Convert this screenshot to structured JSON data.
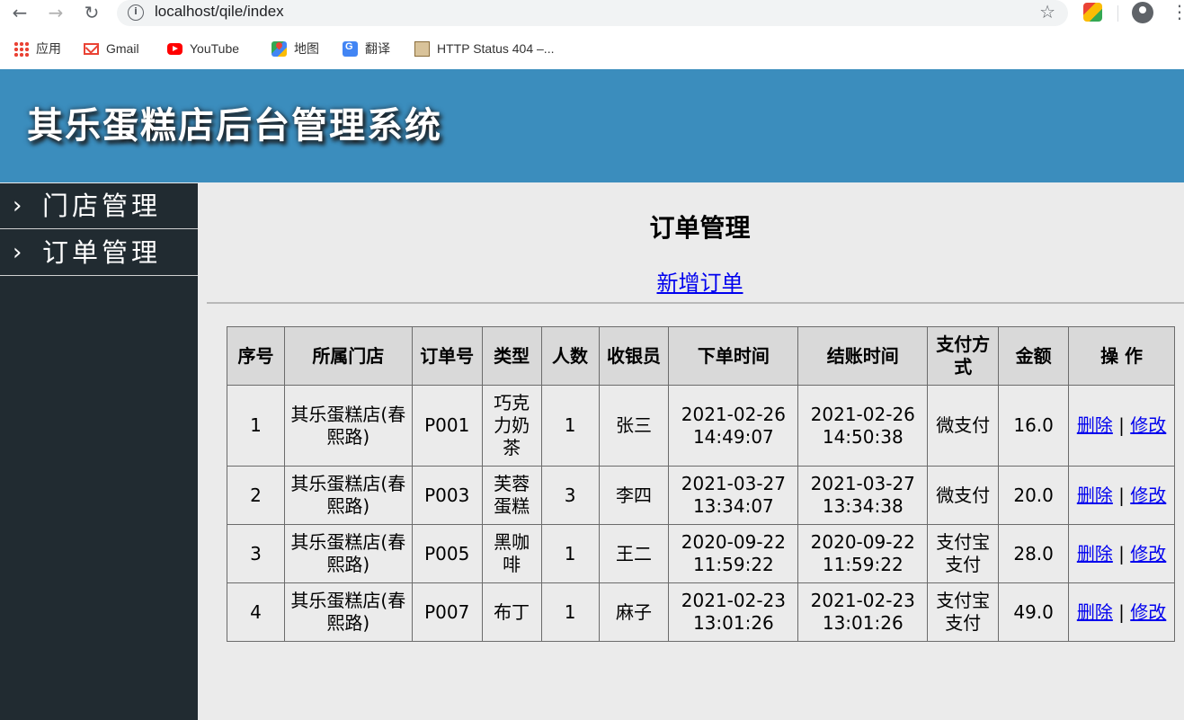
{
  "browser": {
    "url": "localhost/qile/index",
    "bookmarks": [
      {
        "label": "应用",
        "icon": "apps-grid-icon"
      },
      {
        "label": "Gmail",
        "icon": "gmail-icon"
      },
      {
        "label": "YouTube",
        "icon": "youtube-icon"
      },
      {
        "label": "地图",
        "icon": "maps-icon"
      },
      {
        "label": "翻译",
        "icon": "translate-icon"
      },
      {
        "label": "HTTP Status 404 –...",
        "icon": "tomcat-icon"
      }
    ]
  },
  "header": {
    "title": "其乐蛋糕店后台管理系统",
    "bg_color": "#3b8dbd"
  },
  "sidebar": {
    "bg_color": "#212b31",
    "items": [
      {
        "label": "门店管理"
      },
      {
        "label": "订单管理"
      }
    ]
  },
  "main": {
    "title": "订单管理",
    "add_link": "新增订单",
    "table": {
      "headers": [
        "序号",
        "所属门店",
        "订单号",
        "类型",
        "人数",
        "收银员",
        "下单时间",
        "结账时间",
        "支付方式",
        "金额",
        "操 作"
      ],
      "delete_label": "删除",
      "edit_label": "修改",
      "action_sep": "|",
      "rows": [
        {
          "no": "1",
          "store": "其乐蛋糕店(春熙路)",
          "order_no": "P001",
          "type": "巧克力奶茶",
          "people": "1",
          "cashier": "张三",
          "order_date": "2021-02-26",
          "order_time": "14:49:07",
          "pay_date": "2021-02-26",
          "pay_time": "14:50:38",
          "payment": "微支付",
          "amount": "16.0"
        },
        {
          "no": "2",
          "store": "其乐蛋糕店(春熙路)",
          "order_no": "P003",
          "type": "芙蓉蛋糕",
          "people": "3",
          "cashier": "李四",
          "order_date": "2021-03-27",
          "order_time": "13:34:07",
          "pay_date": "2021-03-27",
          "pay_time": "13:34:38",
          "payment": "微支付",
          "amount": "20.0"
        },
        {
          "no": "3",
          "store": "其乐蛋糕店(春熙路)",
          "order_no": "P005",
          "type": "黑咖啡",
          "people": "1",
          "cashier": "王二",
          "order_date": "2020-09-22",
          "order_time": "11:59:22",
          "pay_date": "2020-09-22",
          "pay_time": "11:59:22",
          "payment": "支付宝支付",
          "amount": "28.0"
        },
        {
          "no": "4",
          "store": "其乐蛋糕店(春熙路)",
          "order_no": "P007",
          "type": "布丁",
          "people": "1",
          "cashier": "麻子",
          "order_date": "2021-02-23",
          "order_time": "13:01:26",
          "pay_date": "2021-02-23",
          "pay_time": "13:01:26",
          "payment": "支付宝支付",
          "amount": "49.0"
        }
      ]
    }
  }
}
